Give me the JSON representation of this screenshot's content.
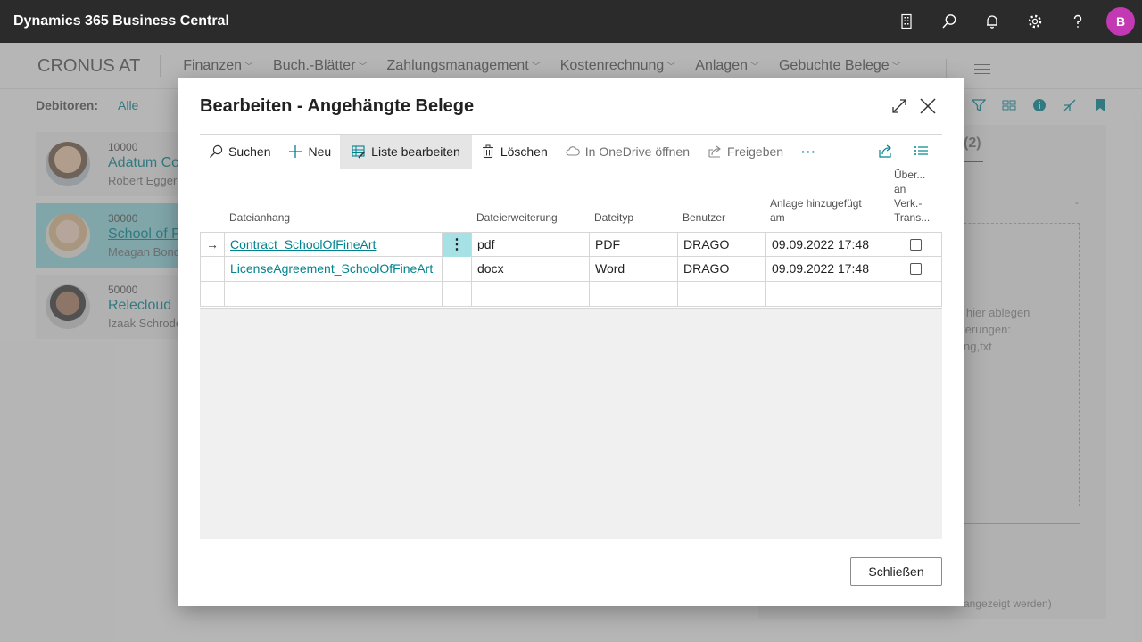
{
  "app": {
    "title": "Dynamics 365 Business Central",
    "avatar_initial": "B"
  },
  "appbar_icons": [
    "building-icon",
    "search-icon",
    "bell-icon",
    "gear-icon",
    "help-icon"
  ],
  "nav": {
    "company": "CRONUS AT",
    "items": [
      "Finanzen",
      "Buch.-Blätter",
      "Zahlungsmanagement",
      "Kostenrechnung",
      "Anlagen",
      "Gebuchte Belege"
    ]
  },
  "filter": {
    "label": "Debitoren:",
    "value": "Alle"
  },
  "customers": [
    {
      "no": "10000",
      "name": "Adatum Co",
      "contact": "Robert Egger"
    },
    {
      "no": "30000",
      "name": "School of F",
      "contact": "Meagan Bond"
    },
    {
      "no": "50000",
      "name": "Relecloud",
      "contact": "Izaak Schrode"
    }
  ],
  "right_pane": {
    "tab_count": "(2)",
    "dash": "-",
    "drop_lines": [
      "n hier ablegen",
      "terungen:",
      "ng,txt"
    ],
    "bottom": "angezeigt werden)"
  },
  "dialog": {
    "title": "Bearbeiten - Angehängte Belege",
    "toolbar": {
      "search": "Suchen",
      "new": "Neu",
      "edit_list": "Liste bearbeiten",
      "delete": "Löschen",
      "onedrive": "In OneDrive öffnen",
      "share": "Freigeben",
      "more": "···"
    },
    "columns": {
      "attachment": "Dateianhang",
      "extension": "Dateierweiterung",
      "type": "Dateityp",
      "user": "Benutzer",
      "added": "Anlage hinzugefügt am",
      "flow": "Über... an Verk.-Trans..."
    },
    "flow_header_lines": [
      "Über...",
      "an",
      "Verk.-",
      "Trans..."
    ],
    "added_header_lines": [
      "Anlage hinzugefügt",
      "am"
    ],
    "rows": [
      {
        "attachment": "Contract_SchoolOfFineArt",
        "extension": "pdf",
        "type": "PDF",
        "user": "DRAGO",
        "added": "09.09.2022 17:48",
        "flow": false
      },
      {
        "attachment": "LicenseAgreement_SchoolOfFineArt",
        "extension": "docx",
        "type": "Word",
        "user": "DRAGO",
        "added": "09.09.2022 17:48",
        "flow": false
      }
    ],
    "row_marker": "→",
    "row_menu": "⋮",
    "close_button": "Schließen"
  }
}
